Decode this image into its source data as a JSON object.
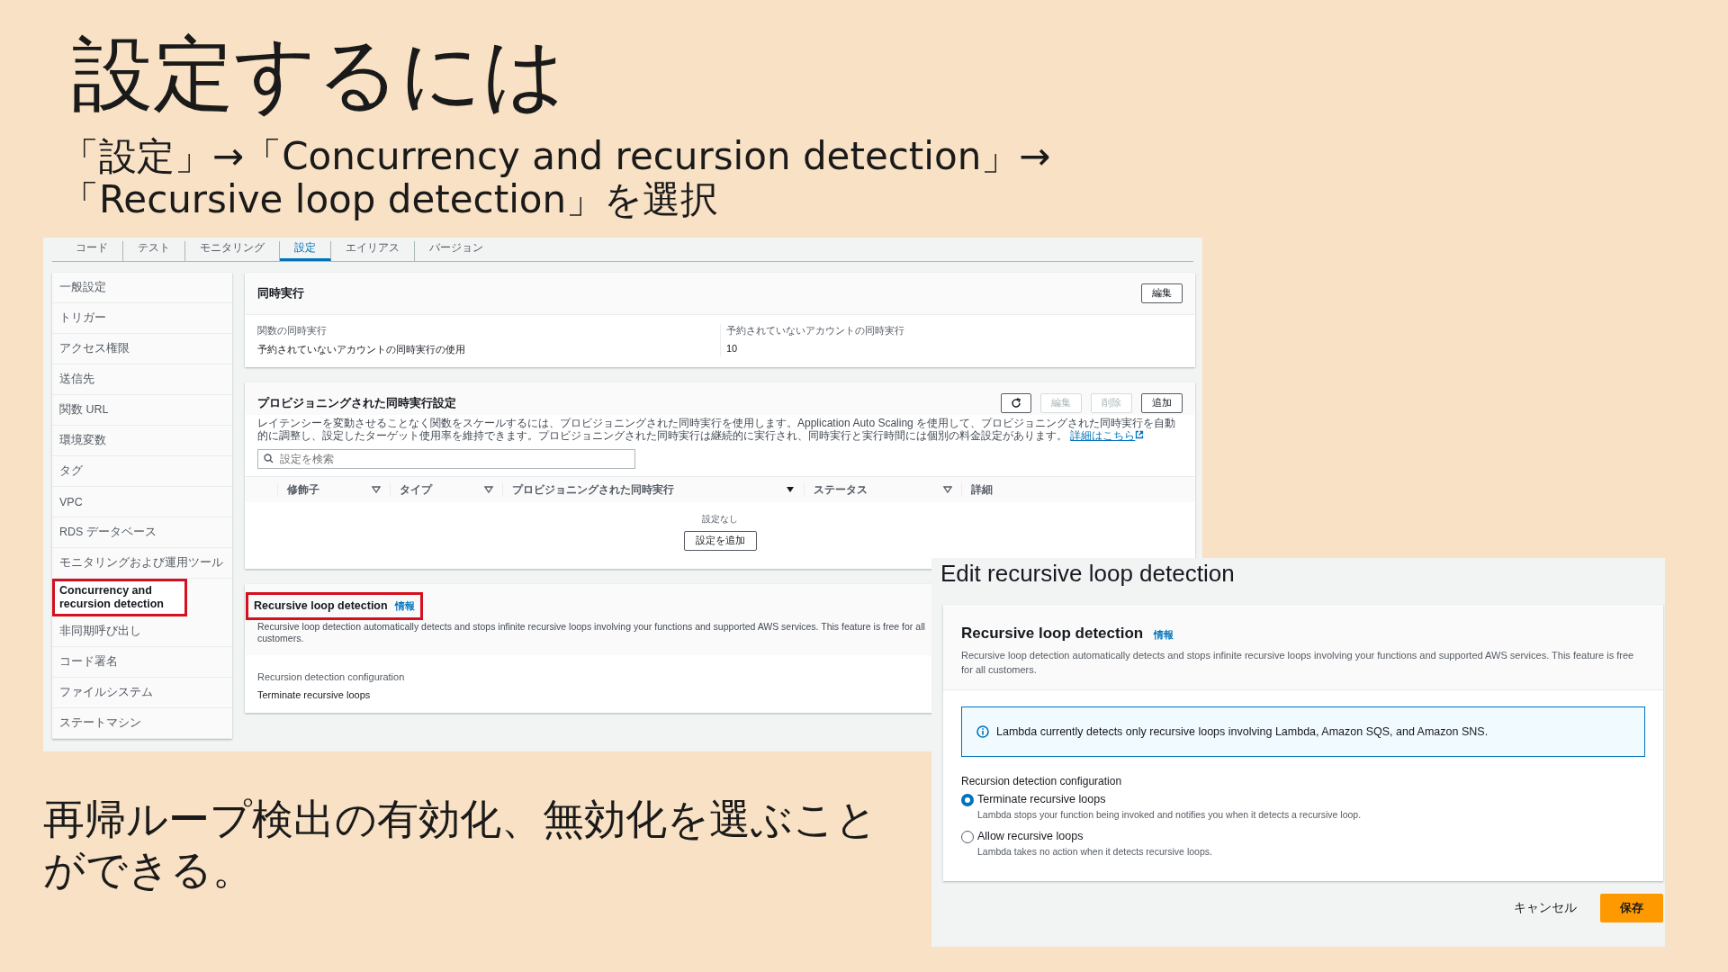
{
  "slide": {
    "title": "設定するには",
    "instruction_lines": [
      "「設定」→「Concurrency and recursion detection」→",
      "「Recursive loop detection」を選択"
    ],
    "caption": "再帰ループ検出の有効化、無効化を選ぶことができる。"
  },
  "console": {
    "tabs": [
      {
        "label": "コード",
        "selected": false
      },
      {
        "label": "テスト",
        "selected": false
      },
      {
        "label": "モニタリング",
        "selected": false
      },
      {
        "label": "設定",
        "selected": true
      },
      {
        "label": "エイリアス",
        "selected": false
      },
      {
        "label": "バージョン",
        "selected": false
      }
    ],
    "sidebar": {
      "items": [
        {
          "label": "一般設定",
          "selected": false,
          "highlighted": false
        },
        {
          "label": "トリガー",
          "selected": false,
          "highlighted": false
        },
        {
          "label": "アクセス権限",
          "selected": false,
          "highlighted": false
        },
        {
          "label": "送信先",
          "selected": false,
          "highlighted": false
        },
        {
          "label": "関数 URL",
          "selected": false,
          "highlighted": false
        },
        {
          "label": "環境変数",
          "selected": false,
          "highlighted": false
        },
        {
          "label": "タグ",
          "selected": false,
          "highlighted": false
        },
        {
          "label": "VPC",
          "selected": false,
          "highlighted": false
        },
        {
          "label": "RDS データベース",
          "selected": false,
          "highlighted": false
        },
        {
          "label": "モニタリングおよび運用ツール",
          "selected": false,
          "highlighted": false
        },
        {
          "label": "Concurrency and recursion detection",
          "selected": true,
          "highlighted": true
        },
        {
          "label": "非同期呼び出し",
          "selected": false,
          "highlighted": false
        },
        {
          "label": "コード署名",
          "selected": false,
          "highlighted": false
        },
        {
          "label": "ファイルシステム",
          "selected": false,
          "highlighted": false
        },
        {
          "label": "ステートマシン",
          "selected": false,
          "highlighted": false
        }
      ]
    },
    "concurrency": {
      "title": "同時実行",
      "edit_button": "編集",
      "fields": [
        {
          "label": "関数の同時実行",
          "value": "予約されていないアカウントの同時実行の使用"
        },
        {
          "label": "予約されていないアカウントの同時実行",
          "value": "10"
        }
      ]
    },
    "provisioned": {
      "title": "プロビジョニングされた同時実行設定",
      "buttons": [
        {
          "kind": "refresh",
          "disabled": false
        },
        {
          "kind": "text",
          "label": "編集",
          "disabled": true
        },
        {
          "kind": "text",
          "label": "削除",
          "disabled": true
        },
        {
          "kind": "text",
          "label": "追加",
          "disabled": false
        }
      ],
      "description": "レイテンシーを変動させることなく関数をスケールするには、プロビジョニングされた同時実行を使用します。Application Auto Scaling を使用して、プロビジョニングされた同時実行を自動的に調整し、設定したターゲット使用率を維持できます。プロビジョニングされた同時実行は継続的に実行され、同時実行と実行時間には個別の料金設定があります。",
      "link": "詳細はこちら",
      "search": {
        "placeholder": "設定を検索"
      },
      "columns": [
        {
          "label": "修飾子",
          "kind": "filterable"
        },
        {
          "label": "タイプ",
          "kind": "filterable"
        },
        {
          "label": "プロビジョニングされた同時実行",
          "kind": "sorted"
        },
        {
          "label": "ステータス",
          "kind": "filterable"
        },
        {
          "label": "詳細",
          "kind": "plain"
        }
      ],
      "empty_text": "設定なし",
      "add_button": "設定を追加"
    },
    "recursion": {
      "title": "Recursive loop detection",
      "info": "情報",
      "highlighted": true,
      "description": "Recursive loop detection automatically detects and stops infinite recursive loops involving your functions and supported AWS services. This feature is free for all customers.",
      "config_label": "Recursion detection configuration",
      "config_value": "Terminate recursive loops"
    }
  },
  "dialog": {
    "title": "Edit recursive loop detection",
    "heading": "Recursive loop detection",
    "info": "情報",
    "description": "Recursive loop detection automatically detects and stops infinite recursive loops involving your functions and supported AWS services. This feature is free for all customers.",
    "notice": "Lambda currently detects only recursive loops involving Lambda, Amazon SQS, and Amazon SNS.",
    "config_label": "Recursion detection configuration",
    "options": [
      {
        "label": "Terminate recursive loops",
        "hint": "Lambda stops your function being invoked and notifies you when it detects a recursive loop.",
        "selected": true
      },
      {
        "label": "Allow recursive loops",
        "hint": "Lambda takes no action when it detects recursive loops.",
        "selected": false
      }
    ],
    "cancel_button": "キャンセル",
    "save_button": "保存"
  }
}
